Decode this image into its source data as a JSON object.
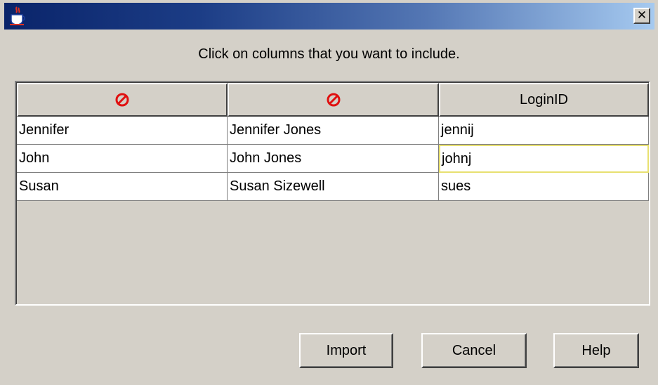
{
  "window": {
    "title": "",
    "close_glyph": "✕"
  },
  "instruction": "Click on columns that you want to include.",
  "table": {
    "columns": [
      {
        "label": "",
        "icon": "excluded-icon",
        "included": false
      },
      {
        "label": "",
        "icon": "excluded-icon",
        "included": false
      },
      {
        "label": "LoginID",
        "included": true
      }
    ],
    "rows": [
      [
        "Jennifer",
        "Jennifer Jones",
        "jennij"
      ],
      [
        "John",
        "John Jones",
        "johnj"
      ],
      [
        "Susan",
        "Susan Sizewell",
        "sues"
      ]
    ]
  },
  "buttons": {
    "import": "Import",
    "cancel": "Cancel",
    "help": "Help"
  },
  "colors": {
    "title_gradient_start": "#0a246a",
    "title_gradient_end": "#a6caf0",
    "excluded_icon": "#e01010",
    "focus_border": "#e8e070"
  }
}
